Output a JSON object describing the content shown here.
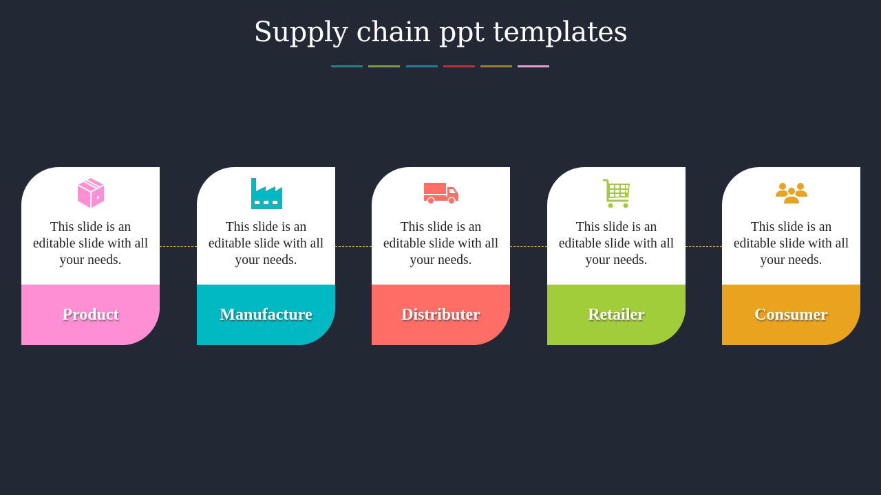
{
  "slide": {
    "title": "Supply chain ppt templates",
    "background": "#222935",
    "underline_colors": [
      "#0E8A90",
      "#7E9F2C",
      "#0E82B5",
      "#E32121",
      "#B07A16",
      "#FF8FD4"
    ],
    "connector_color": "#E8A21F"
  },
  "cards": [
    {
      "label": "Product",
      "icon": "package-box-icon",
      "description": "This slide is an editable slide with all your needs.",
      "color": "#FF8FD4"
    },
    {
      "label": "Manufacture",
      "icon": "factory-icon",
      "description": "This slide is an editable slide with all your needs.",
      "color": "#00B9C3"
    },
    {
      "label": "Distributer",
      "icon": "delivery-truck-icon",
      "description": "This slide is an editable slide with all your needs.",
      "color": "#FF6E66"
    },
    {
      "label": "Retailer",
      "icon": "shopping-cart-icon",
      "description": "This slide is an editable slide with all your needs.",
      "color": "#A2CD3A"
    },
    {
      "label": "Consumer",
      "icon": "people-group-icon",
      "description": "This slide is an editable slide with all your needs.",
      "color": "#EAA31E"
    }
  ]
}
